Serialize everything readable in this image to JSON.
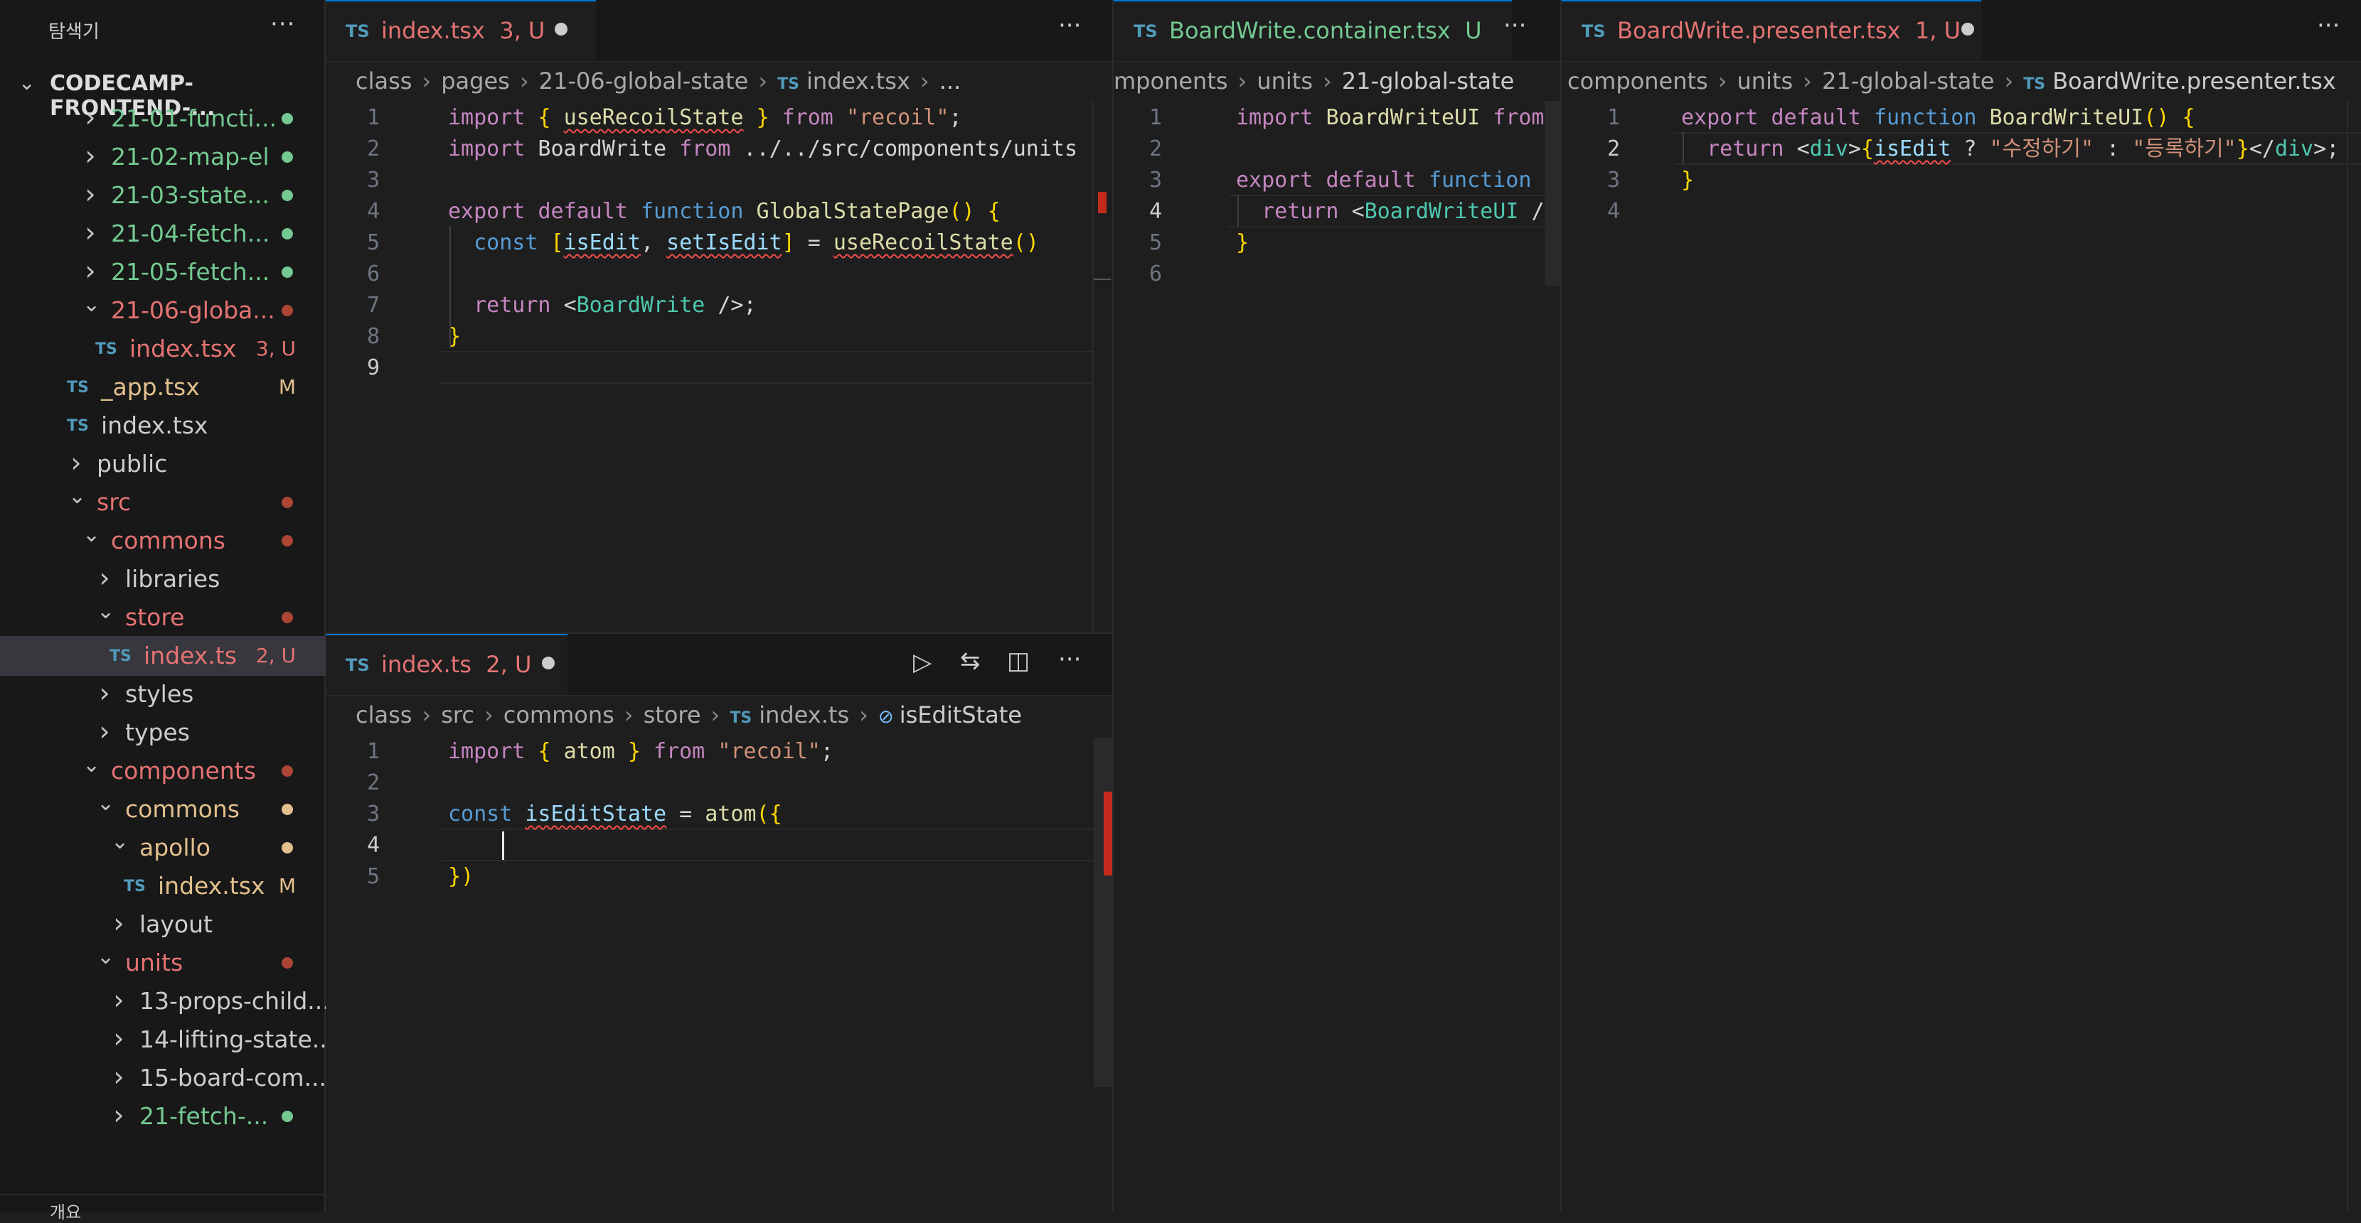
{
  "sidebar": {
    "title": "탐색기",
    "project": "CODECAMP-FRONTEND-...",
    "items": [
      {
        "label": "21-01-functi...",
        "type": "folder",
        "color": "green",
        "status": "dot-green"
      },
      {
        "label": "21-02-map-el",
        "type": "folder",
        "color": "green",
        "status": "dot-green"
      },
      {
        "label": "21-03-state...",
        "type": "folder",
        "color": "green",
        "status": "dot-green"
      },
      {
        "label": "21-04-fetch...",
        "type": "folder",
        "color": "green",
        "status": "dot-green"
      },
      {
        "label": "21-05-fetch...",
        "type": "folder",
        "color": "green",
        "status": "dot-green"
      },
      {
        "label": "21-06-globa...",
        "type": "folder-open",
        "color": "red",
        "status": "dot-red"
      },
      {
        "label": "index.tsx",
        "type": "file",
        "color": "red",
        "badge": "3, U"
      },
      {
        "label": "_app.tsx",
        "type": "file",
        "color": "yellow",
        "badge": "M"
      },
      {
        "label": "index.tsx",
        "type": "file",
        "color": "white"
      },
      {
        "label": "public",
        "type": "folder",
        "color": "white"
      },
      {
        "label": "src",
        "type": "folder-open",
        "color": "red",
        "status": "dot-red"
      },
      {
        "label": "commons",
        "type": "folder-open",
        "color": "red",
        "status": "dot-red"
      },
      {
        "label": "libraries",
        "type": "folder",
        "color": "white"
      },
      {
        "label": "store",
        "type": "folder-open",
        "color": "red",
        "status": "dot-red"
      },
      {
        "label": "index.ts",
        "type": "file",
        "color": "red",
        "badge": "2, U"
      },
      {
        "label": "styles",
        "type": "folder",
        "color": "white"
      },
      {
        "label": "types",
        "type": "folder",
        "color": "white"
      },
      {
        "label": "components",
        "type": "folder-open",
        "color": "red",
        "status": "dot-red"
      },
      {
        "label": "commons",
        "type": "folder-open",
        "color": "yellow",
        "status": "dot-yellow"
      },
      {
        "label": "apollo",
        "type": "folder-open",
        "color": "yellow",
        "status": "dot-yellow"
      },
      {
        "label": "index.tsx",
        "type": "file",
        "color": "yellow",
        "badge": "M"
      },
      {
        "label": "layout",
        "type": "folder",
        "color": "white"
      },
      {
        "label": "units",
        "type": "folder-open",
        "color": "red",
        "status": "dot-red"
      },
      {
        "label": "13-props-child...",
        "type": "folder",
        "color": "white"
      },
      {
        "label": "14-lifting-state...",
        "type": "folder",
        "color": "white"
      },
      {
        "label": "15-board-com...",
        "type": "folder",
        "color": "white"
      },
      {
        "label": "21-fetch-...",
        "type": "folder",
        "color": "green",
        "status": "dot-green"
      }
    ],
    "outline_label": "개요"
  },
  "group1": {
    "tab": {
      "name": "index.tsx",
      "badge": "3, U"
    },
    "breadcrumb": [
      "class",
      "pages",
      "21-06-global-state",
      "index.tsx",
      "..."
    ],
    "lines": [
      "import { useRecoilState } from \"recoil\";",
      "import BoardWrite from \"../../src/components/units",
      "",
      "export default function GlobalStatePage() {",
      "  const [isEdit, setIsEdit] = useRecoilState()",
      "",
      "  return <BoardWrite />;",
      "}",
      ""
    ]
  },
  "group2": {
    "tab": {
      "name": "index.ts",
      "badge": "2, U"
    },
    "breadcrumb": [
      "class",
      "src",
      "commons",
      "store",
      "index.ts",
      "isEditState"
    ],
    "lines": [
      "import { atom } from \"recoil\";",
      "",
      "const isEditState = atom({",
      "",
      "})"
    ]
  },
  "group3": {
    "tab": {
      "name": "BoardWrite.container.tsx",
      "badge": "U"
    },
    "breadcrumb": [
      "mponents",
      "units",
      "21-global-state"
    ],
    "lines": [
      "import BoardWriteUI from",
      "",
      "export default function",
      "  return <BoardWriteUI />",
      "}",
      ""
    ]
  },
  "group4": {
    "tab": {
      "name": "BoardWrite.presenter.tsx",
      "badge": "1, U"
    },
    "breadcrumb": [
      "components",
      "units",
      "21-global-state",
      "BoardWrite.presenter.tsx"
    ],
    "lines": [
      "export default function BoardWriteUI() {",
      "  return <div>{isEdit ? \"수정하기\" : \"등록하기\"}</div>;",
      "}",
      ""
    ]
  },
  "icons": [
    "chevron-down-icon",
    "chevron-right-icon",
    "typescript-file-icon",
    "more-icon",
    "run-icon",
    "compare-icon",
    "split-editor-icon",
    "symbol-variable-icon"
  ],
  "colors": {
    "green": "#73c991",
    "red": "#e57373",
    "yellow": "#e2c08d",
    "accent": "#0078d4"
  }
}
